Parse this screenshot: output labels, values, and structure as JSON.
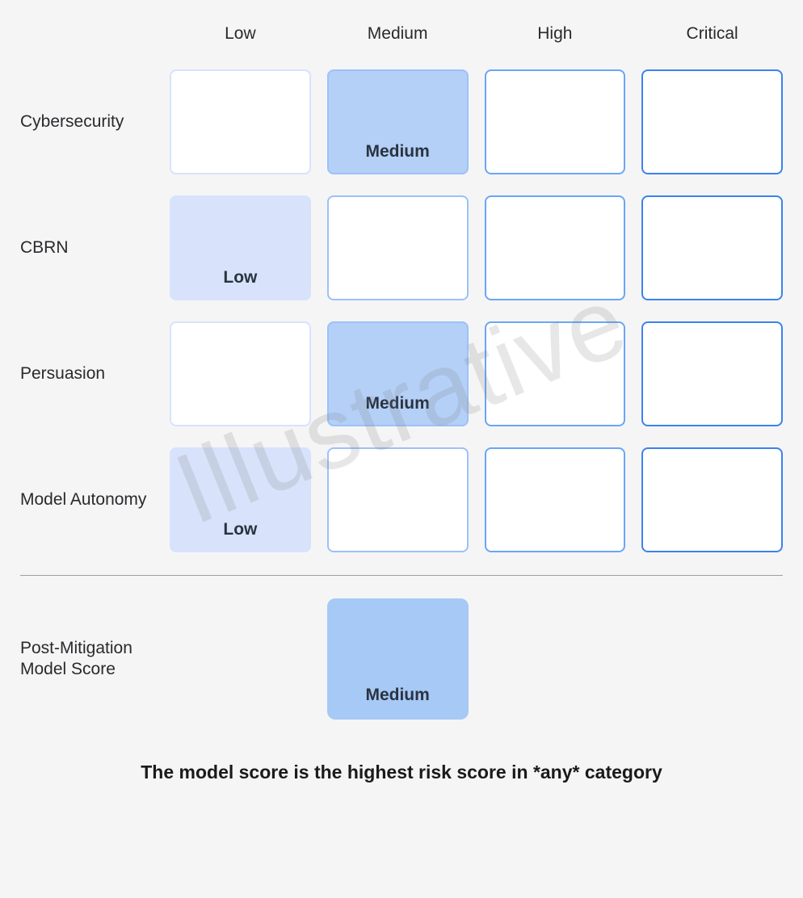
{
  "headers": {
    "low": "Low",
    "medium": "Medium",
    "high": "High",
    "critical": "Critical"
  },
  "rows": [
    {
      "label": "Cybersecurity",
      "selected": "Medium",
      "selected_col": 1
    },
    {
      "label": "CBRN",
      "selected": "Low",
      "selected_col": 0
    },
    {
      "label": "Persuasion",
      "selected": "Medium",
      "selected_col": 1
    },
    {
      "label": "Model Autonomy",
      "selected": "Low",
      "selected_col": 0
    }
  ],
  "score": {
    "label": "Post-Mitigation Model Score",
    "value": "Medium",
    "col": 1
  },
  "footer": "The model score is the highest risk score in *any* category",
  "watermark": "Illustrative",
  "chart_data": {
    "type": "table",
    "columns": [
      "Low",
      "Medium",
      "High",
      "Critical"
    ],
    "rows": [
      {
        "category": "Cybersecurity",
        "score": "Medium"
      },
      {
        "category": "CBRN",
        "score": "Low"
      },
      {
        "category": "Persuasion",
        "score": "Medium"
      },
      {
        "category": "Model Autonomy",
        "score": "Low"
      }
    ],
    "overall": {
      "label": "Post-Mitigation Model Score",
      "score": "Medium"
    },
    "note": "The model score is the highest risk score in *any* category"
  }
}
